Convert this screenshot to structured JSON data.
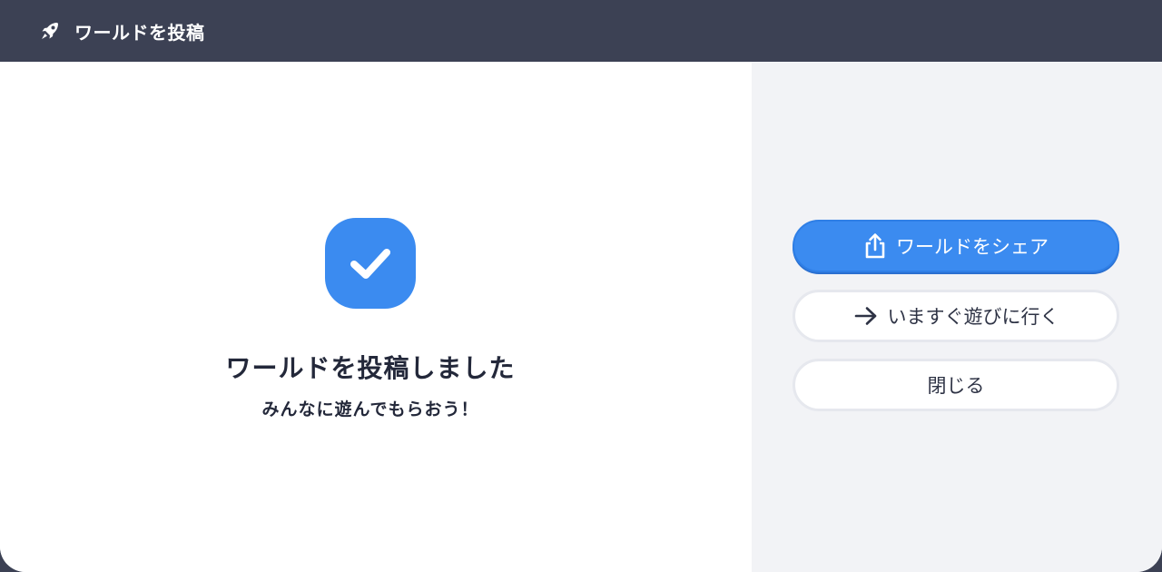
{
  "header": {
    "title": "ワールドを投稿",
    "icon": "rocket-icon"
  },
  "success": {
    "icon": "check-icon",
    "title": "ワールドを投稿しました",
    "subtitle": "みんなに遊んでもらおう！"
  },
  "actions": {
    "share_label": "ワールドをシェア",
    "share_icon": "share-icon",
    "play_label": "いますぐ遊びに行く",
    "play_icon": "arrow-right-icon",
    "close_label": "閉じる"
  },
  "colors": {
    "header_bg": "#3c4154",
    "accent": "#3b8bf0",
    "side_panel_bg": "#f2f3f6",
    "text_dark": "#23283a"
  }
}
